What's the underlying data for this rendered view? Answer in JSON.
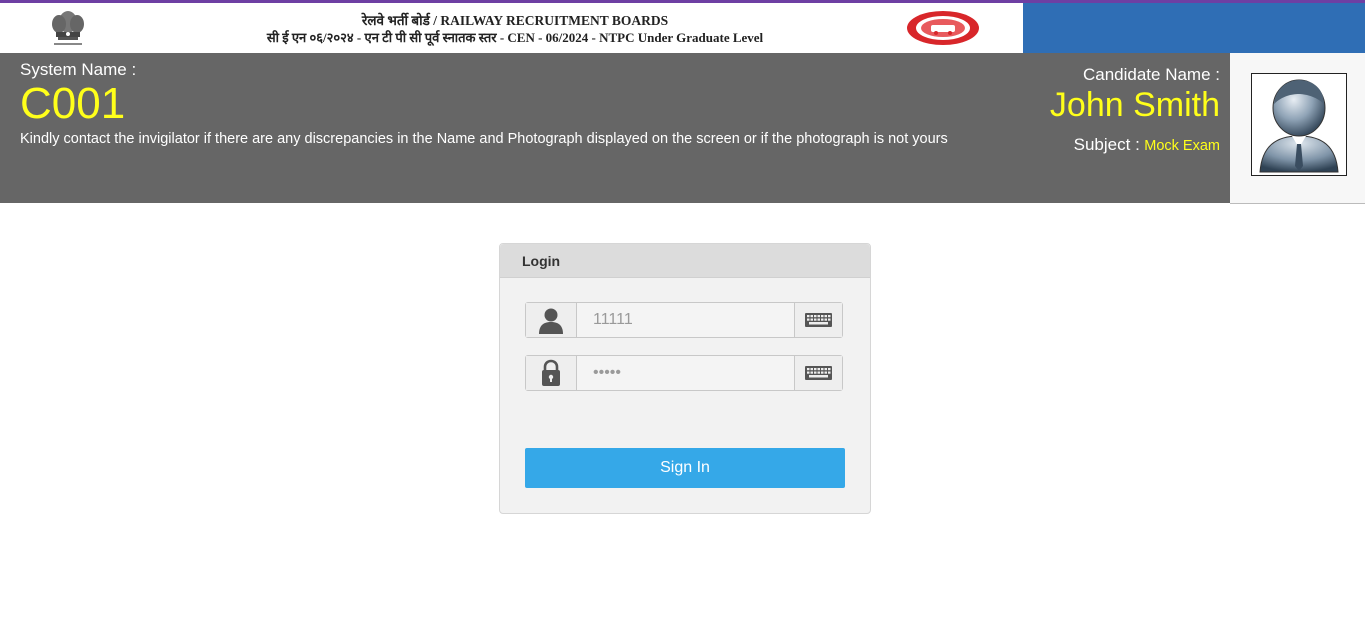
{
  "banner": {
    "line1": "रेलवे भर्ती बोर्ड / RAILWAY RECRUITMENT BOARDS",
    "line2": "सी ई एन ०६/२०२४ - एन टी पी सी पूर्व स्नातक स्तर - CEN - 06/2024 - NTPC Under Graduate Level",
    "emblem_icon": "state-emblem-icon",
    "logo_icon": "indian-railways-logo-icon",
    "accent_color": "#2f6eb5",
    "top_border_color": "#6e3fa3"
  },
  "system": {
    "label": "System Name :",
    "value": "C001"
  },
  "notice": "Kindly contact the invigilator if there are any discrepancies in the Name and Photograph displayed on the screen or if the photograph is not yours",
  "candidate": {
    "label": "Candidate Name :",
    "name": "John Smith",
    "subject_label": "Subject :",
    "subject_value": "Mock Exam",
    "photo_icon": "candidate-avatar-icon"
  },
  "login": {
    "title": "Login",
    "username": {
      "icon": "user-icon",
      "placeholder": "11111",
      "value": "",
      "keyboard_icon": "keyboard-icon"
    },
    "password": {
      "icon": "lock-icon",
      "placeholder": "•••••",
      "value": "",
      "keyboard_icon": "keyboard-icon"
    },
    "submit_label": "Sign In",
    "button_color": "#35a8e8"
  },
  "colors": {
    "info_bar": "#666666",
    "highlight_text": "#ffff1a"
  }
}
